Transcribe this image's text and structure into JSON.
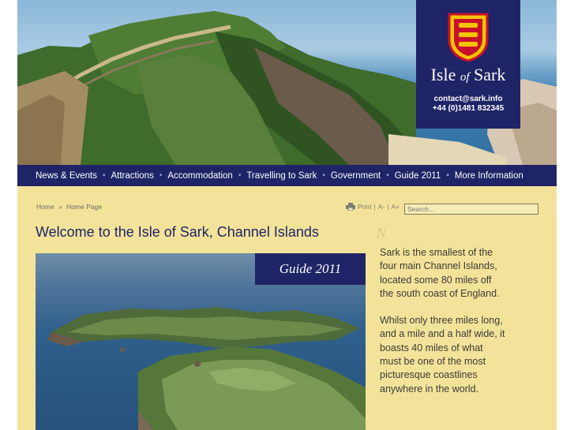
{
  "brand": {
    "title_part1": "Isle",
    "title_of": "of",
    "title_part2": "Sark",
    "email": "contact@sark.info",
    "phone": "+44 (0)1481 832345",
    "colors": {
      "navy": "#1f2466",
      "parchment": "#f3e39a",
      "crest_red": "#c8102e",
      "crest_gold": "#f5c400"
    }
  },
  "nav": {
    "items": [
      {
        "label": "News & Events"
      },
      {
        "label": "Attractions"
      },
      {
        "label": "Accommodation"
      },
      {
        "label": "Travelling to Sark"
      },
      {
        "label": "Government"
      },
      {
        "label": "Guide 2011"
      },
      {
        "label": "More Information"
      }
    ],
    "separator": "•"
  },
  "breadcrumb": {
    "home": "Home",
    "separator": "»",
    "current": "Home Page"
  },
  "tools": {
    "print": "Print",
    "text_smaller": "A-",
    "text_larger": "A+",
    "divider": "|"
  },
  "search": {
    "placeholder": "Search..."
  },
  "main": {
    "heading": "Welcome to the Isle of Sark, Channel Islands",
    "guide_tag": "Guide 2011",
    "compass_letter": "N",
    "intro_paragraphs": [
      "Sark is the smallest of the four main Channel Islands, located some 80 miles off the south coast of England.",
      "Whilst only three miles long, and a mile and a half wide, it boasts 40 miles of what must be one of the most picturesque coastlines anywhere in the world."
    ]
  }
}
